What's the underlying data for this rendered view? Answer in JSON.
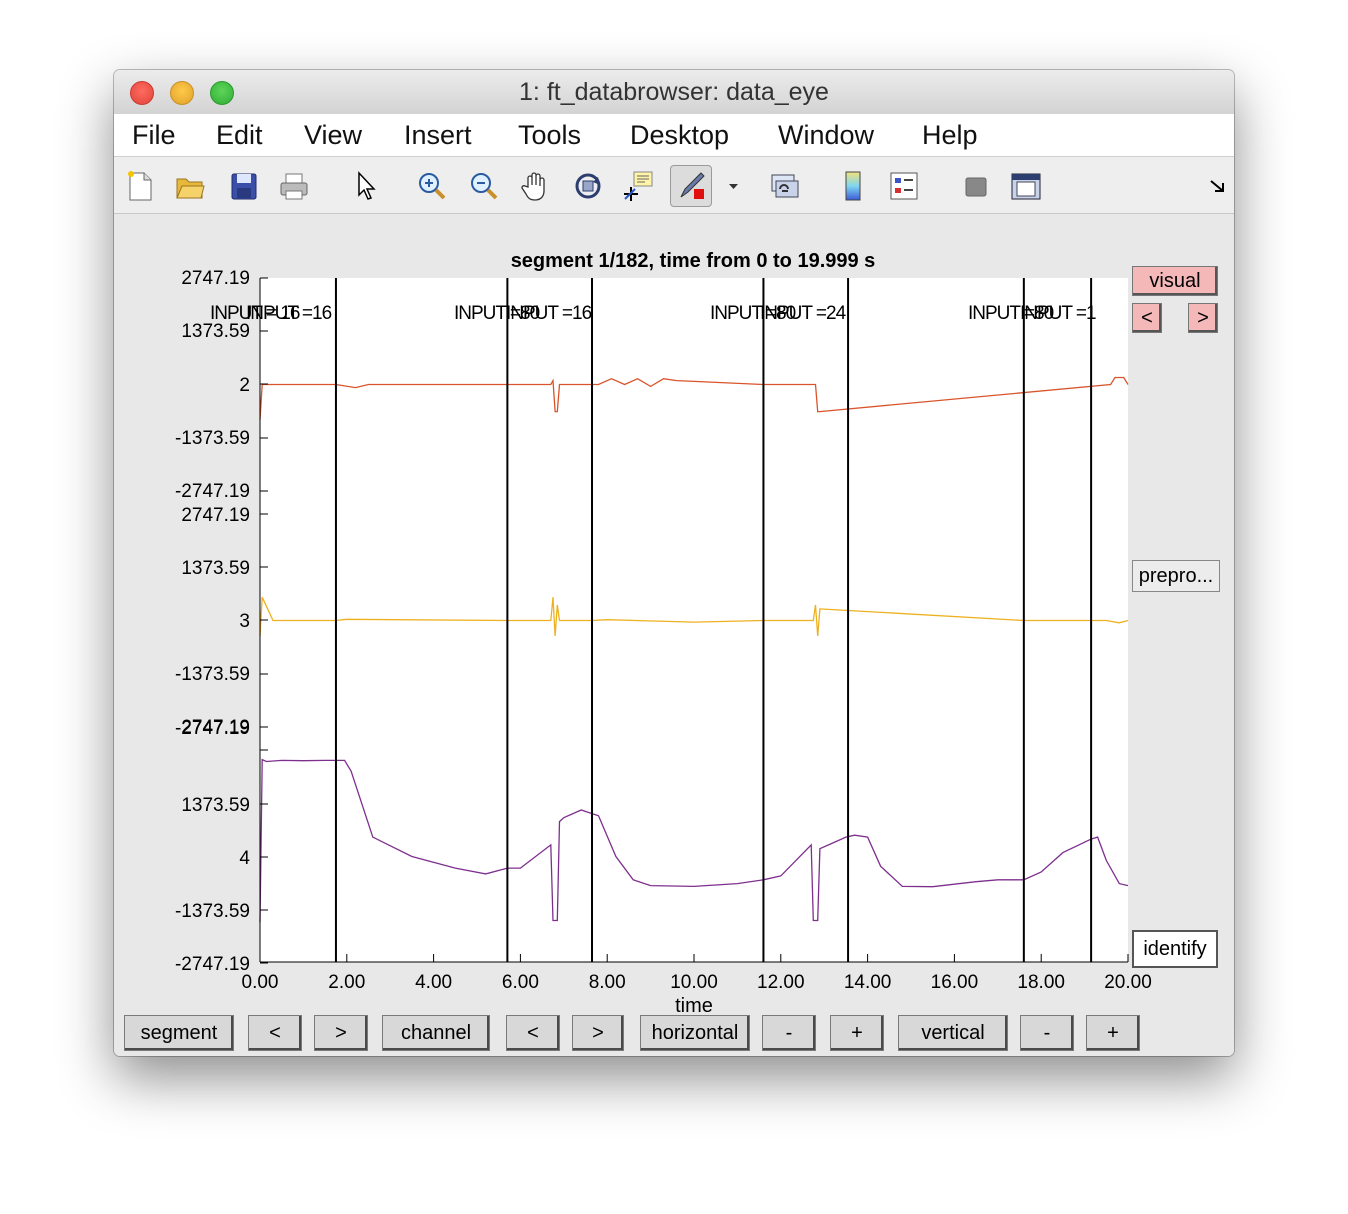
{
  "window": {
    "title": "1: ft_databrowser: data_eye"
  },
  "menubar": {
    "items": [
      "File",
      "Edit",
      "View",
      "Insert",
      "Tools",
      "Desktop",
      "Window",
      "Help"
    ]
  },
  "toolbar": {
    "icons": [
      "new-figure-icon",
      "open-file-icon",
      "save-icon",
      "print-icon",
      "edit-plot-arrow-icon",
      "zoom-in-icon",
      "zoom-out-icon",
      "pan-hand-icon",
      "rotate-3d-icon",
      "data-cursor-icon",
      "brush-icon",
      "brush-dropdown-icon",
      "link-plot-icon",
      "colorbar-icon",
      "legend-icon",
      "hide-plot-tools-icon",
      "show-plot-tools-icon",
      "dock-icon"
    ]
  },
  "plot": {
    "title": "segment 1/182, time from 0 to 19.999 s",
    "xlabel": "time",
    "xticks": [
      "0.00",
      "2.00",
      "4.00",
      "6.00",
      "8.00",
      "10.00",
      "12.00",
      "14.00",
      "16.00",
      "18.00",
      "20.00"
    ],
    "yticks": [
      "2747.19",
      "1373.59",
      "2",
      "-1373.59",
      "-2747.19",
      "2747.19",
      "1373.59",
      "3",
      "-1373.59",
      "-2747.19",
      "2747.19",
      "1373.59",
      "4",
      "-1373.59",
      "-2747.19"
    ],
    "event_labels": [
      "INPUT = 16",
      "INPUT =16",
      "INPUT =80",
      "INPUT =16",
      "INPUT =80",
      "INPUT =24",
      "INPUT =80",
      "INPUT =1"
    ]
  },
  "chart_data": {
    "type": "line",
    "title": "segment 1/182, time from 0 to 19.999 s",
    "xlabel": "time",
    "ylabel": "",
    "xlim": [
      0,
      20
    ],
    "channels": [
      {
        "name": "2",
        "color": "#d9542b",
        "ylim": [
          -2747.19,
          2747.19
        ]
      },
      {
        "name": "3",
        "color": "#edb11f",
        "ylim": [
          -2747.19,
          2747.19
        ]
      },
      {
        "name": "4",
        "color": "#7e2f8e",
        "ylim": [
          -2747.19,
          2747.19
        ]
      }
    ],
    "event_times": [
      1.75,
      5.7,
      7.65,
      11.6,
      13.55,
      17.6,
      19.15
    ],
    "series": [
      {
        "name": "2",
        "x": [
          0,
          0.05,
          0.3,
          1.75,
          2.2,
          2.5,
          5.7,
          6.7,
          6.75,
          6.8,
          6.85,
          6.9,
          7.8,
          8.1,
          8.4,
          8.7,
          9.0,
          9.3,
          9.6,
          10.0,
          11.6,
          12.75,
          12.8,
          12.85,
          12.9,
          19.6,
          19.7,
          19.9,
          20.0
        ],
        "y": [
          -900,
          0,
          0,
          0,
          -80,
          0,
          0,
          0,
          100,
          -700,
          -700,
          0,
          0,
          150,
          0,
          150,
          -50,
          150,
          100,
          80,
          0,
          0,
          0,
          -700,
          -700,
          0,
          180,
          180,
          0
        ]
      },
      {
        "name": "3",
        "x": [
          0,
          0.05,
          0.3,
          1.75,
          2.0,
          5.7,
          6.7,
          6.75,
          6.8,
          6.85,
          6.9,
          7.65,
          8.0,
          10.0,
          11.6,
          12.75,
          12.8,
          12.85,
          12.9,
          17.6,
          19.5,
          19.8,
          20.0
        ],
        "y": [
          -400,
          600,
          0,
          0,
          30,
          0,
          0,
          600,
          -400,
          400,
          0,
          0,
          20,
          -40,
          0,
          0,
          400,
          -400,
          300,
          0,
          0,
          -60,
          0
        ]
      },
      {
        "name": "4",
        "x": [
          0,
          0.05,
          0.15,
          0.5,
          1.0,
          1.5,
          1.95,
          2.1,
          2.6,
          3.5,
          4.5,
          5.2,
          5.7,
          6.0,
          6.7,
          6.75,
          6.85,
          6.9,
          7.0,
          7.4,
          7.8,
          8.2,
          8.6,
          9.0,
          10.0,
          11.0,
          11.6,
          12.0,
          12.7,
          12.75,
          12.85,
          12.9,
          13.1,
          13.5,
          13.7,
          14.0,
          14.3,
          14.8,
          15.5,
          16.5,
          17.0,
          17.6,
          18.0,
          18.5,
          19.15,
          19.3,
          19.5,
          19.8,
          20.0
        ],
        "y": [
          -1700,
          2500,
          2450,
          2480,
          2470,
          2480,
          2480,
          2200,
          500,
          0,
          -300,
          -450,
          -300,
          -300,
          300,
          -1650,
          -1650,
          900,
          1000,
          1200,
          1050,
          0,
          -600,
          -750,
          -770,
          -700,
          -600,
          -500,
          300,
          -1650,
          -1650,
          200,
          300,
          500,
          550,
          500,
          -250,
          -770,
          -780,
          -650,
          -600,
          -600,
          -400,
          100,
          450,
          500,
          -100,
          -700,
          -750
        ]
      }
    ]
  },
  "side": {
    "visual_label": "visual",
    "prev_label": "<",
    "next_label": ">",
    "prepro_label": "prepro...",
    "identify_label": "identify"
  },
  "bottom": {
    "segment_label": "segment",
    "segment_prev": "<",
    "segment_next": ">",
    "channel_label": "channel",
    "channel_prev": "<",
    "channel_next": ">",
    "horizontal_label": "horizontal",
    "horizontal_minus": "-",
    "horizontal_plus": "+",
    "vertical_label": "vertical",
    "vertical_minus": "-",
    "vertical_plus": "+"
  }
}
